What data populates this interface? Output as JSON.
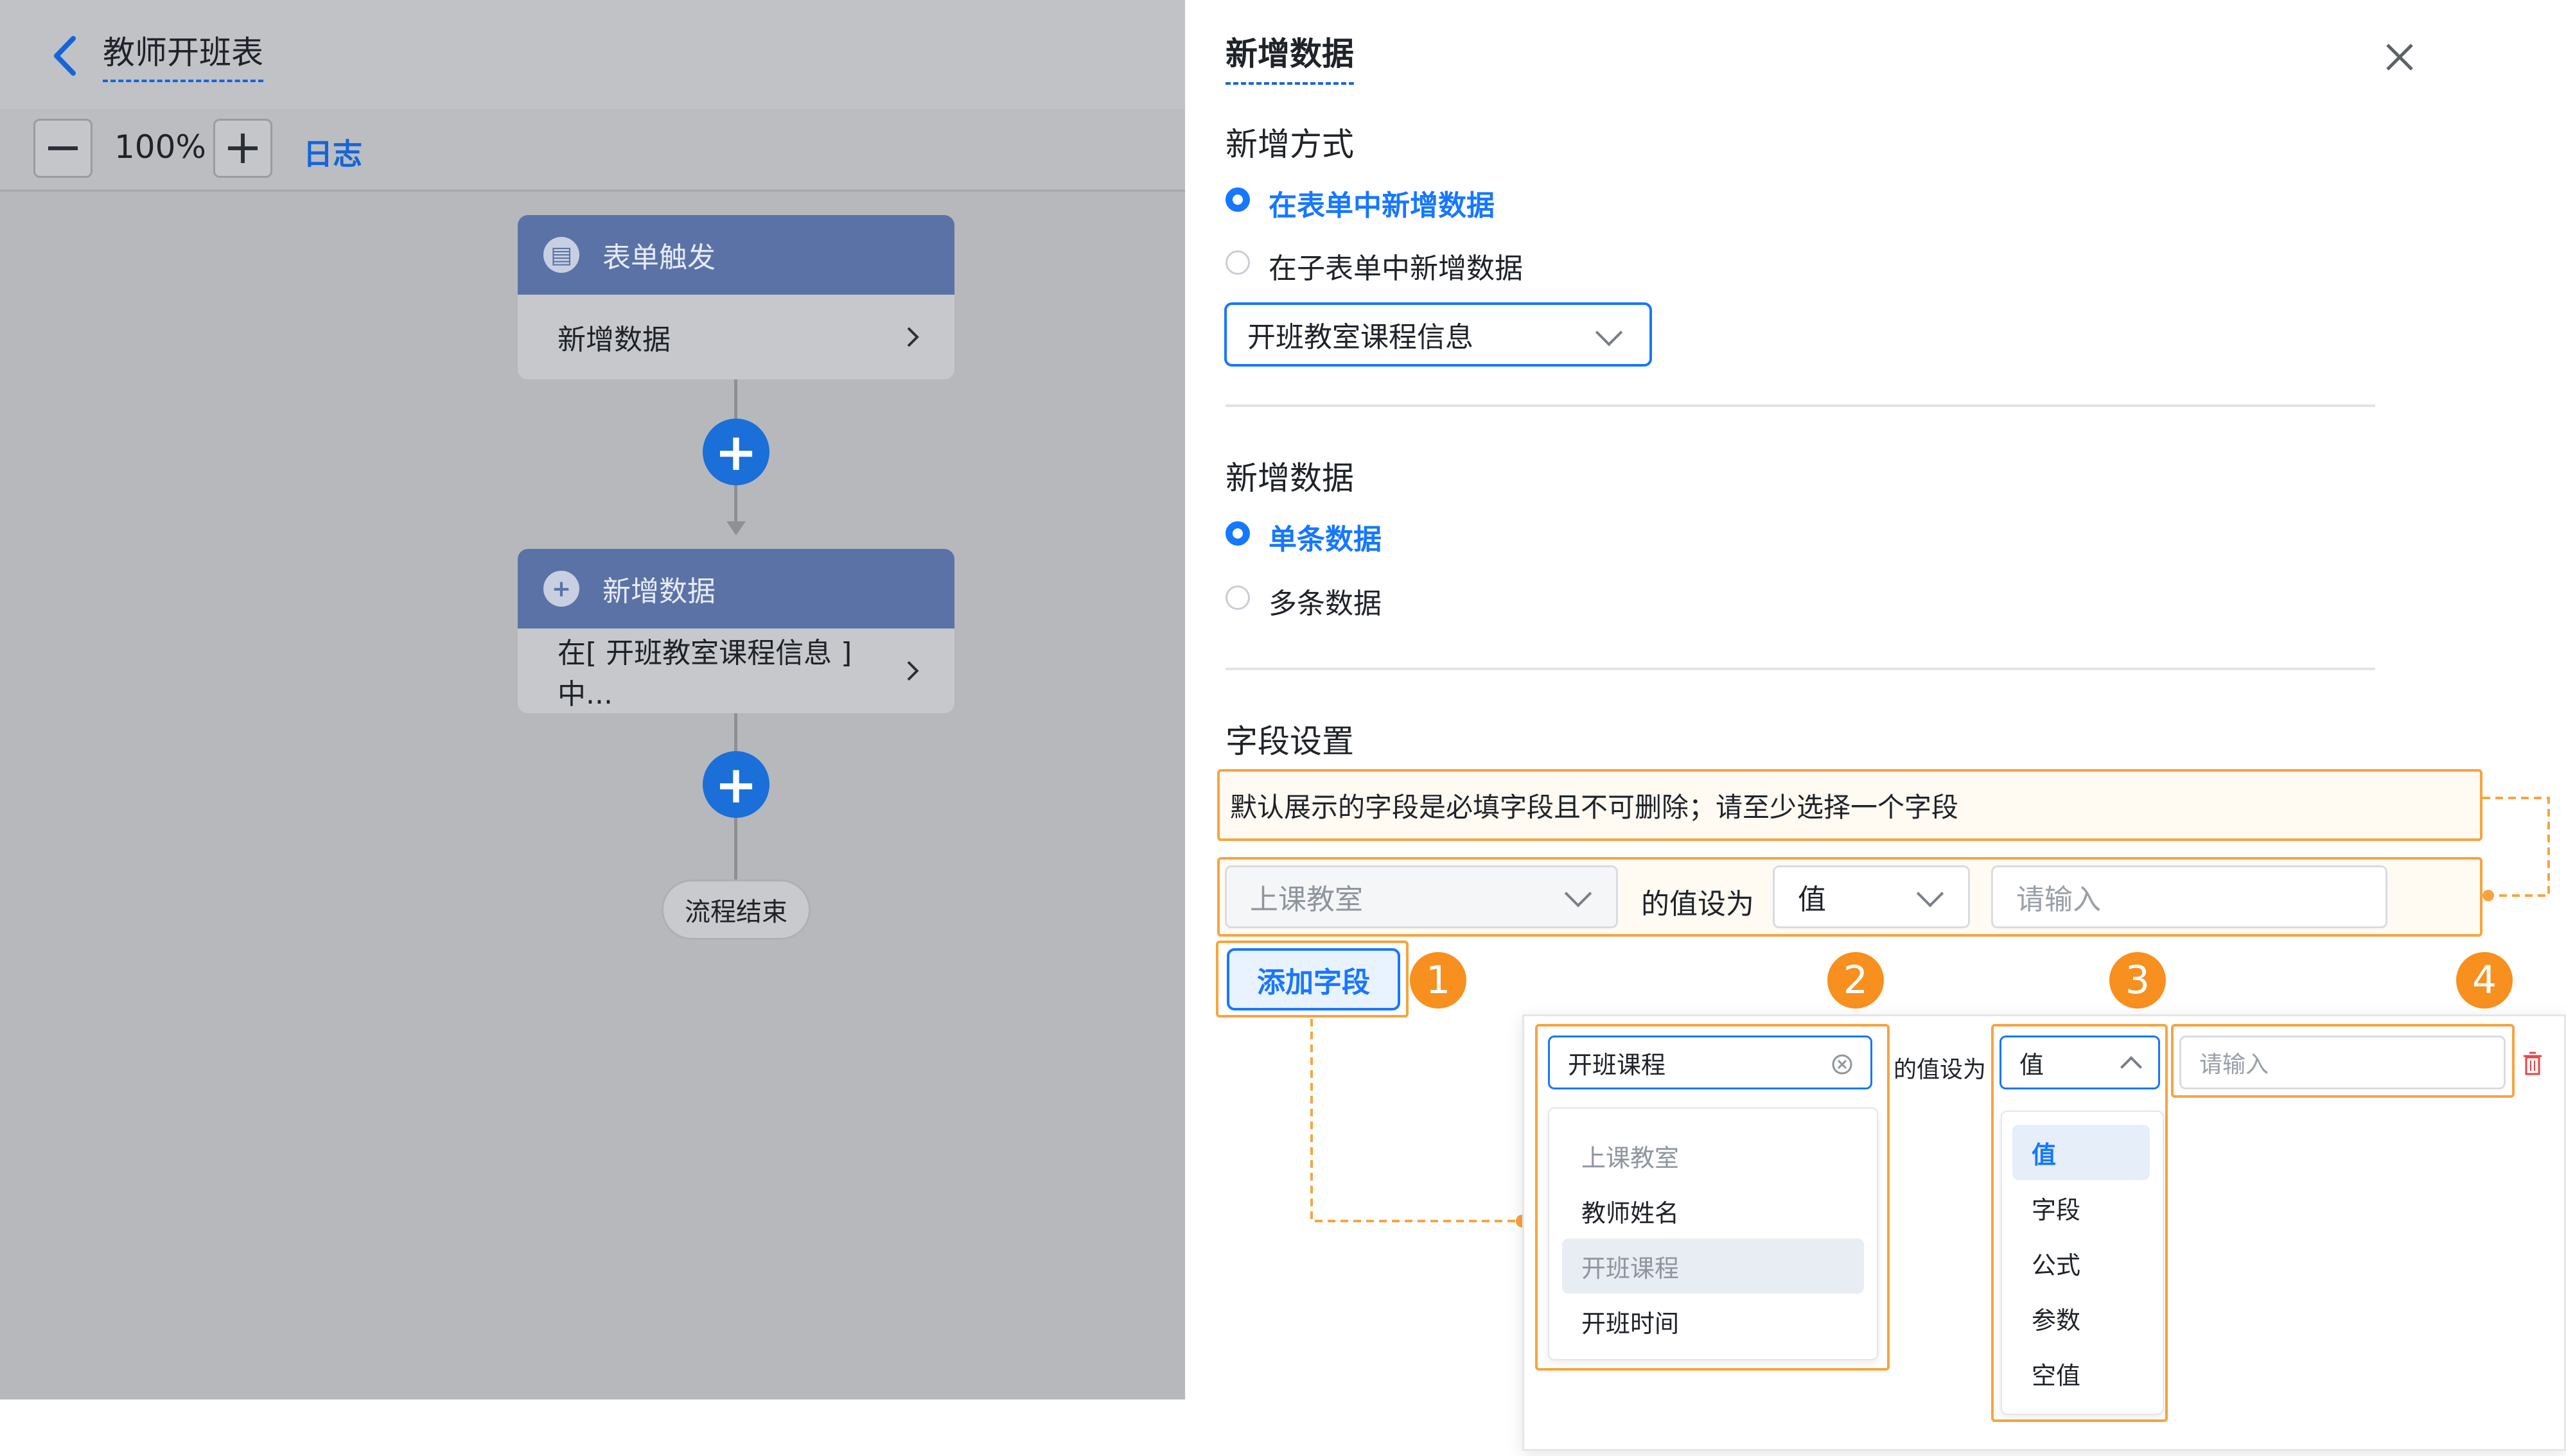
{
  "header": {
    "title": "教师开班表",
    "zoom": "100%",
    "log_label": "日志"
  },
  "flow": {
    "trigger_title": "表单触发",
    "trigger_body": "新增数据",
    "action_title": "新增数据",
    "action_body": "在[ 开班教室课程信息 ]中...",
    "end_label": "流程结束"
  },
  "panel": {
    "title": "新增数据",
    "method_section": "新增方式",
    "method_options": [
      "在表单中新增数据",
      "在子表单中新增数据"
    ],
    "form_select_value": "开班教室课程信息",
    "data_section": "新增数据",
    "data_options": [
      "单条数据",
      "多条数据"
    ],
    "field_section": "字段设置",
    "tip": "默认展示的字段是必填字段且不可删除；请至少选择一个字段",
    "row": {
      "field": "上课教室",
      "connector": "的值设为",
      "type": "值",
      "placeholder": "请输入"
    },
    "add_field_label": "添加字段"
  },
  "callout": {
    "badges": [
      "1",
      "2",
      "3",
      "4"
    ],
    "field_search_value": "开班课程",
    "field_options": [
      "上课教室",
      "教师姓名",
      "开班课程",
      "开班时间"
    ],
    "connector": "的值设为",
    "type_value": "值",
    "type_options": [
      "值",
      "字段",
      "公式",
      "参数",
      "空值"
    ],
    "value_placeholder": "请输入"
  },
  "colors": {
    "accent": "#1677ff",
    "node_header": "#5b72a6",
    "annotation": "#f7a440",
    "badge": "#f7901e",
    "delete": "#e84545"
  }
}
